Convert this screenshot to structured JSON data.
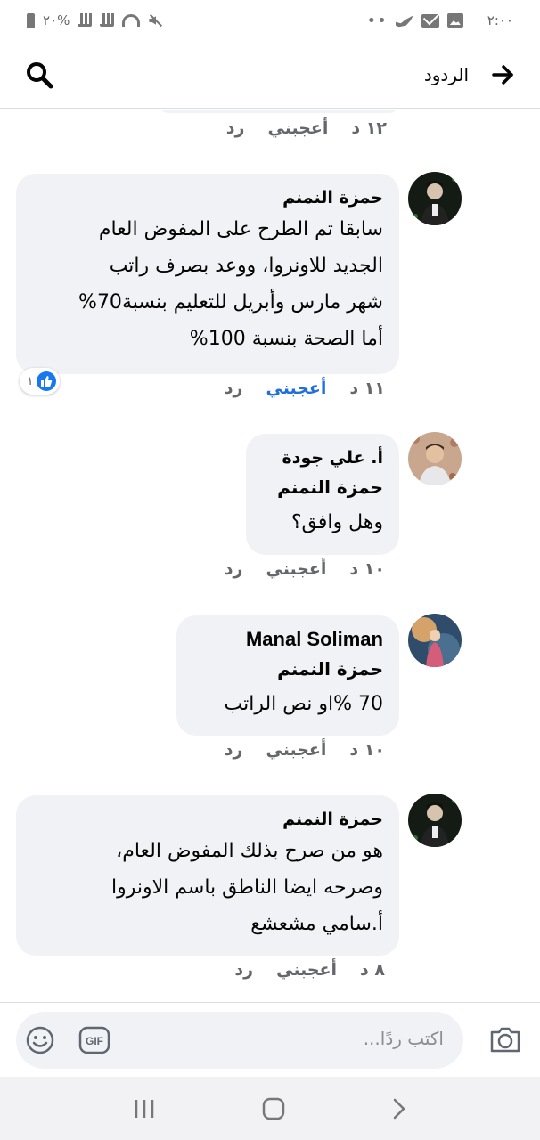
{
  "status_bar": {
    "battery_text": "٢٠%",
    "time": "٢:٠٠",
    "dots": "••"
  },
  "header": {
    "title": "الردود"
  },
  "partial_comment": {
    "time": "١٢ د",
    "like_label": "أعجبني",
    "reply_label": "رد"
  },
  "comments": [
    {
      "author": "حمزة النمنم",
      "lines": [
        "سابقا تم الطرح على المفوض العام",
        "الجديد للاونروا، ووعد بصرف راتب",
        "شهر مارس وأبريل للتعليم بنسبة70%",
        "أما الصحة بنسبة 100%"
      ],
      "time": "١١ د",
      "like_label": "أعجبني",
      "reply_label": "رد",
      "reaction_count": "١"
    },
    {
      "author": "أ. علي جودة",
      "mention": "حمزة النمنم",
      "lines": [
        "وهل وافق؟"
      ],
      "time": "١٠ د",
      "like_label": "أعجبني",
      "reply_label": "رد"
    },
    {
      "author": "Manal Soliman",
      "mention": "حمزة النمنم",
      "lines": [
        "70 %او نص الراتب"
      ],
      "time": "١٠ د",
      "like_label": "أعجبني",
      "reply_label": "رد"
    },
    {
      "author": "حمزة النمنم",
      "lines": [
        "هو من صرح بذلك المفوض العام،",
        "وصرحه ايضا الناطق باسم الاونروا",
        "أ.سامي مشعشع"
      ],
      "time": "٨ د",
      "like_label": "أعجبني",
      "reply_label": "رد"
    }
  ],
  "composer": {
    "placeholder": "اكتب ردًا...",
    "gif_label": "GIF"
  },
  "colors": {
    "bubble": "#f0f2f5",
    "like_blue": "#216fdb",
    "meta_gray": "#65676b"
  }
}
